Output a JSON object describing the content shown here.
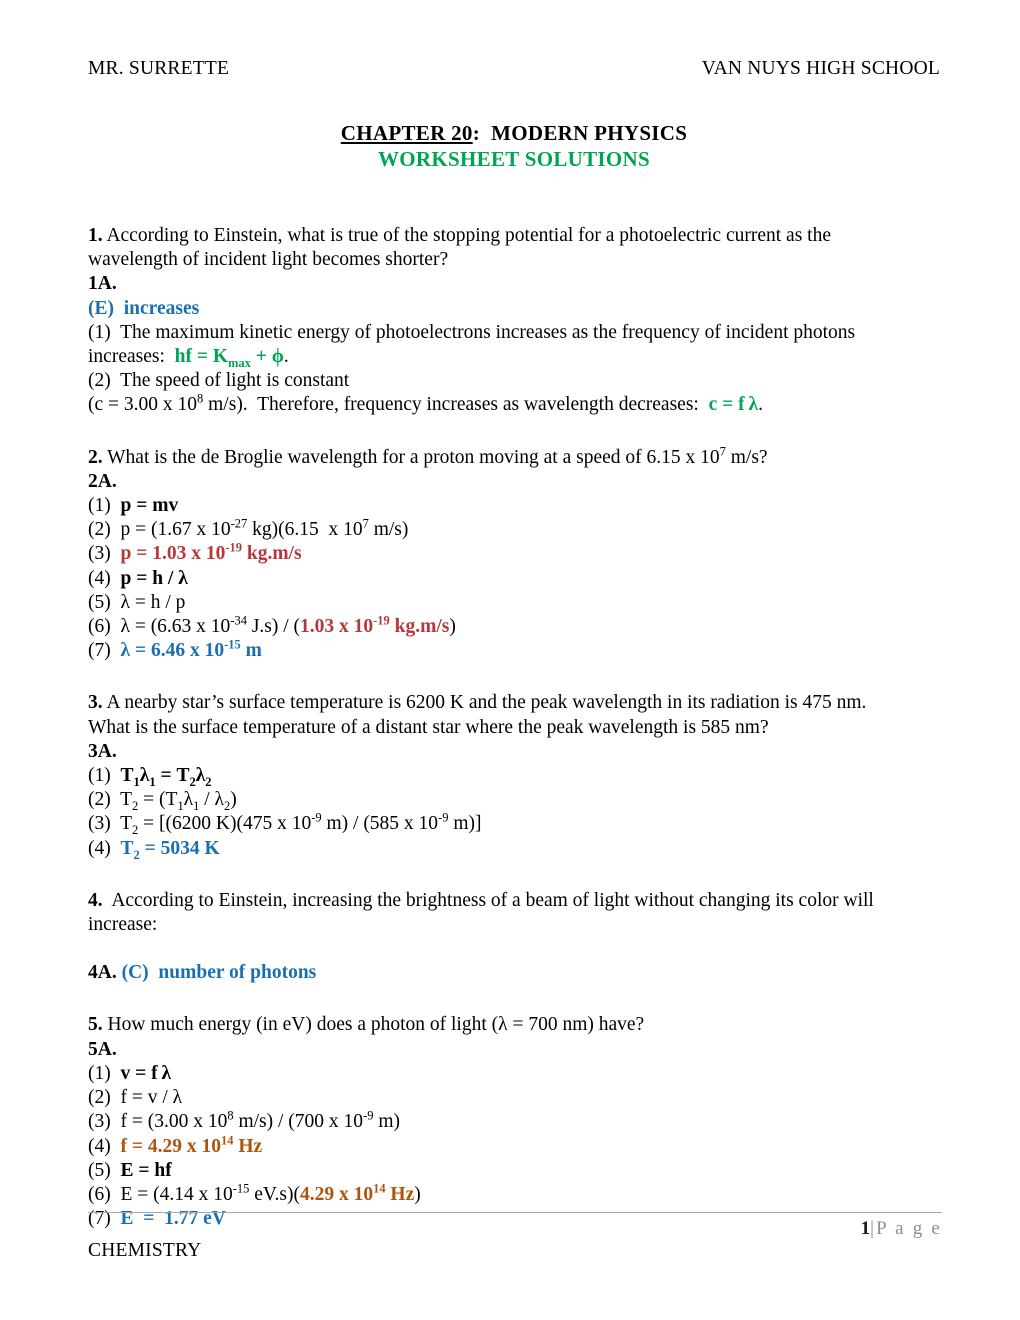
{
  "header": {
    "left": "MR. SURRETTE",
    "right": "VAN NUYS HIGH SCHOOL"
  },
  "title": {
    "chapter_underlined": "CHAPTER 20",
    "chapter_rest": ":  MODERN PHYSICS",
    "subtitle": "WORKSHEET SOLUTIONS",
    "subtitle_color": "#00a550"
  },
  "colors": {
    "answer_blue": "#1a6fb0",
    "formula_green": "#00a550",
    "intermediate_red": "#b8373a",
    "intermediate_orange": "#b0540c",
    "body_black": "#000000"
  },
  "questions": [
    {
      "number": "1.",
      "prompt_line_1": "According to Einstein, what is true of the stopping potential for a photoelectric current as the",
      "prompt_line_2": "wavelength of incident light becomes shorter?",
      "answer_label": "1A.",
      "choice": "(E)  increases",
      "steps": [
        "(1)  The maximum kinetic energy of photoelectrons increases as the frequency of incident photons",
        "increases:  hf = Kmax + ϕ.",
        "(2)  The speed of light is constant",
        "(c = 3.00 x 108 m/s).  Therefore, frequency increases as wavelength decreases:  c = f λ."
      ]
    },
    {
      "number": "2.",
      "prompt_line_1": "What is the de Broglie wavelength for a proton moving at a speed of 6.15 x 107 m/s?",
      "answer_label": "2A.",
      "steps": [
        "(1)  p = mv",
        "(2)  p = (1.67 x 10-27 kg)(6.15  x 107 m/s)",
        "(3)  p = 1.03 x 10-19 kg.m/s",
        "(4)  p = h / λ",
        "(5)  λ = h / p",
        "(6)  λ = (6.63 x 10-34 J.s) / (1.03 x 10-19 kg.m/s)",
        "(7)  λ = 6.46 x 10-15 m"
      ]
    },
    {
      "number": "3.",
      "prompt_line_1": "A nearby star’s surface temperature is 6200 K and the peak wavelength in its radiation is 475 nm.",
      "prompt_line_2": "What is the surface temperature of a distant star where the peak wavelength is 585 nm?",
      "answer_label": "3A.",
      "steps": [
        "(1)  T1λ1 = T2λ2",
        "(2)  T2 = (T1λ1 / λ2)",
        "(3)  T2 = [(6200 K)(475 x 10-9 m) / (585 x 10-9 m)]",
        "(4)  T2 = 5034 K"
      ]
    },
    {
      "number": "4.",
      "prompt_line_1": "According to Einstein, increasing the brightness of a beam of light without changing its color will",
      "prompt_line_2": "increase:",
      "answer_label": "4A.",
      "choice": "(C)  number of photons"
    },
    {
      "number": "5.",
      "prompt_line_1": "How much energy (in eV) does a photon of light (λ = 700 nm) have?",
      "answer_label": "5A.",
      "steps": [
        "(1)  v = f λ",
        "(2)  f = v / λ",
        "(3)  f = (3.00 x 108 m/s) / (700 x 10-9 m)",
        "(4)  f = 4.29 x 1014 Hz",
        "(5)  E = hf",
        "(6)  E = (4.14 x 10-15 eV.s)(4.29 x 1014 Hz)",
        "(7)  E  =  1.77 eV"
      ]
    }
  ],
  "footer": {
    "page_number": "1",
    "page_separator": "|",
    "page_word": "P a g e",
    "subject": "CHEMISTRY"
  }
}
